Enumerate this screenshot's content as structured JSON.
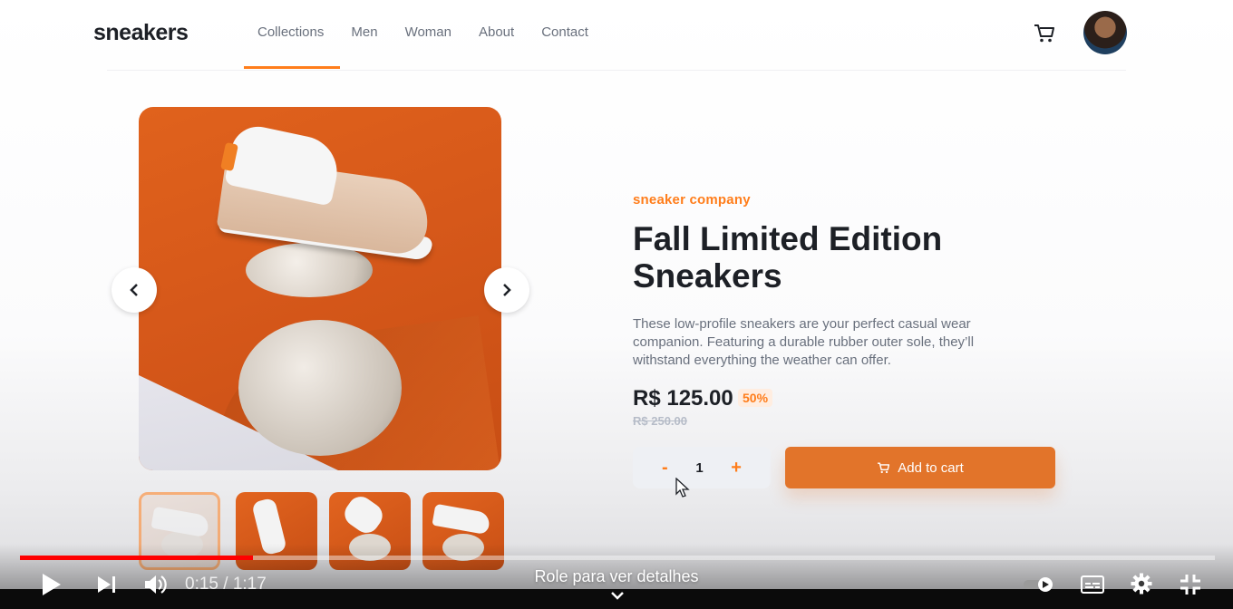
{
  "header": {
    "logo": "sneakers",
    "nav": [
      "Collections",
      "Men",
      "Woman",
      "About",
      "Contact"
    ],
    "active_nav": "Collections"
  },
  "product": {
    "company": "sneaker company",
    "title": "Fall Limited Edition Sneakers",
    "description": "These low-profile sneakers are your perfect casual wear companion. Featuring a durable rubber outer sole, they’ll withstand everything the weather can offer.",
    "price": "R$ 125.00",
    "discount": "50%",
    "old_price": "R$ 250.00",
    "quantity": "1",
    "minus": "-",
    "plus": "+",
    "add_to_cart": "Add to cart"
  },
  "gallery": {
    "thumbnails": 4,
    "active_thumbnail": 1
  },
  "player": {
    "time": "0:15 / 1:17",
    "progress": 0.195,
    "scroll_hint": "Role para ver detalhes"
  },
  "colors": {
    "accent": "#ff7d1a",
    "progress": "#ff0000",
    "text_dark": "#1d2026",
    "text_grey": "#69707d"
  }
}
